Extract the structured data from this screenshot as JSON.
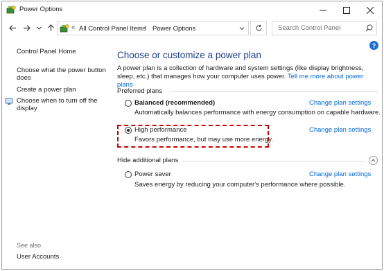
{
  "window": {
    "title": "Power Options",
    "minimize_icon": "minimize-icon",
    "maximize_icon": "maximize-icon",
    "close_icon": "close-icon"
  },
  "address_bar": {
    "overflow_chevron": "«",
    "crumbs": [
      "All Control Panel Items",
      "Power Options"
    ],
    "separator": "›"
  },
  "search": {
    "placeholder": "Search Control Panel"
  },
  "help": {
    "label": "?"
  },
  "left_pane": {
    "links": [
      "Control Panel Home",
      "Choose what the power button does",
      "Create a power plan",
      "Choose when to turn off the display"
    ],
    "see_also_label": "See also",
    "see_also_links": [
      "User Accounts"
    ]
  },
  "main": {
    "heading": "Choose or customize a power plan",
    "intro_text": "A power plan is a collection of hardware and system settings (like display brightness, sleep, etc.) that manages how your computer uses power.",
    "intro_link": "Tell me more about power plans",
    "preferred_label": "Preferred plans",
    "hidden_label": "Hide additional plans",
    "plans": [
      {
        "name": "Balanced (recommended)",
        "description": "Automatically balances performance with energy consumption on capable hardware.",
        "link": "Change plan settings",
        "selected": false
      },
      {
        "name": "High performance",
        "description": "Favors performance, but may use more energy.",
        "link": "Change plan settings",
        "selected": true
      },
      {
        "name": "Power saver",
        "description": "Saves energy by reducing your computer's performance where possible.",
        "link": "Change plan settings",
        "selected": false
      }
    ]
  },
  "colors": {
    "heading": "#1e3c8c",
    "link": "#0066cc",
    "highlight": "#cc0000"
  }
}
